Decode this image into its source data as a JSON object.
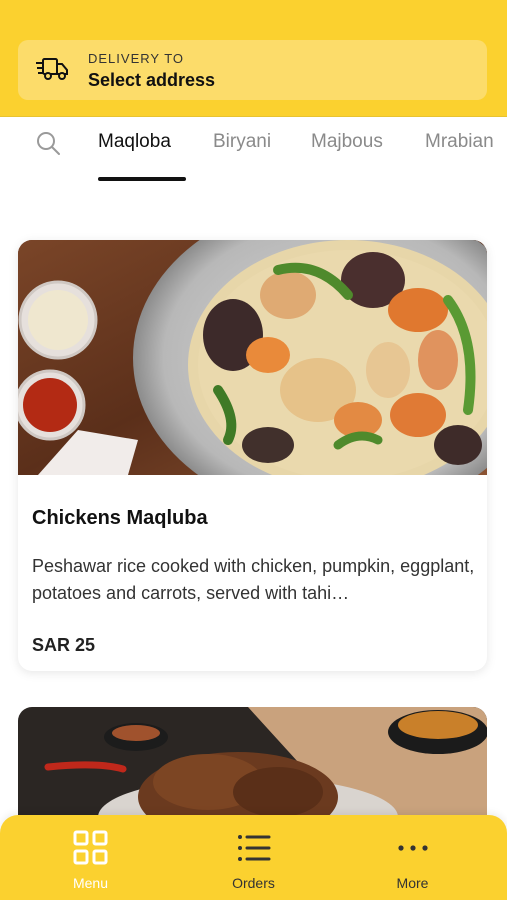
{
  "header": {
    "delivery_label": "DELIVERY TO",
    "delivery_value": "Select address",
    "icon": "delivery-truck-icon",
    "bg_color": "#fbd12f"
  },
  "tabs": [
    {
      "label": "Maqloba",
      "active": true
    },
    {
      "label": "Biryani",
      "active": false
    },
    {
      "label": "Majbous",
      "active": false
    },
    {
      "label": "Mrabian",
      "active": false
    }
  ],
  "items": [
    {
      "title": "Chickens Maqluba",
      "description": "Peshawar rice cooked with chicken, pumpkin, eggplant, potatoes and carrots, served with tahi…",
      "price": "SAR 25"
    }
  ],
  "bottom_nav": [
    {
      "label": "Menu",
      "icon": "grid-icon",
      "active": true
    },
    {
      "label": "Orders",
      "icon": "list-icon",
      "active": false
    },
    {
      "label": "More",
      "icon": "more-dots-icon",
      "active": false
    }
  ]
}
